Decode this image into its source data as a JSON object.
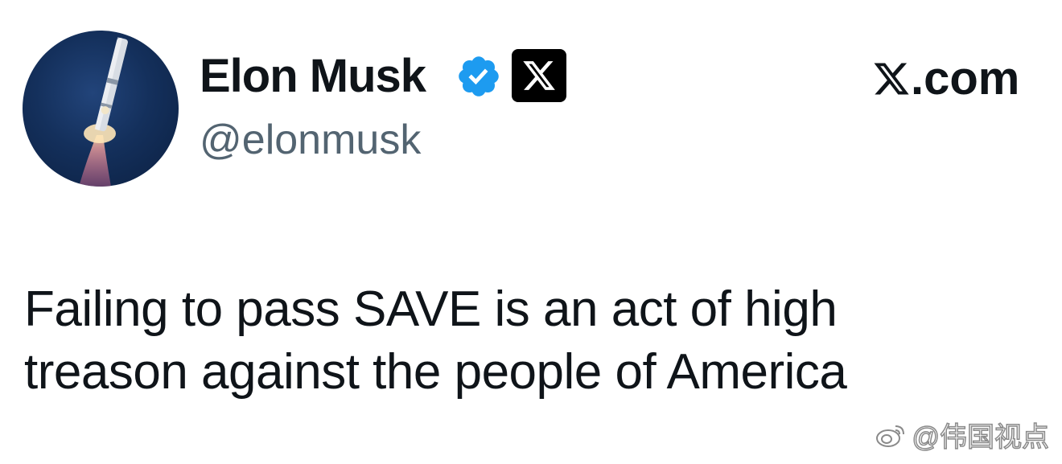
{
  "post": {
    "display_name": "Elon Musk",
    "handle": "@elonmusk",
    "source": ".com",
    "text_lines": [
      "Failing to pass SAVE is an act of high",
      "treason against the people of America"
    ]
  },
  "watermark": {
    "text": "@伟国视点"
  },
  "icons": {
    "avatar": "rocket-launch-avatar",
    "verified": "verified-check-icon",
    "affiliate": "x-logo-icon",
    "source": "x-logo-icon",
    "watermark": "weibo-icon"
  },
  "colors": {
    "verified_blue": "#1d9bf0",
    "handle_gray": "#536471",
    "text": "#0f1419"
  }
}
